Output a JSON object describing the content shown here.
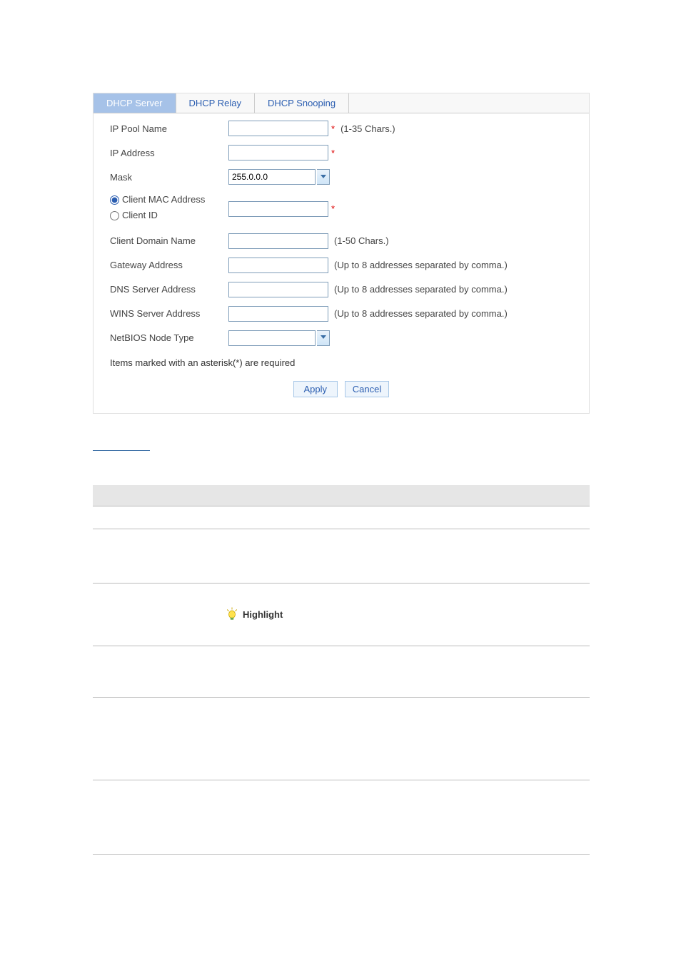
{
  "tabs": {
    "server": "DHCP Server",
    "relay": "DHCP Relay",
    "snooping": "DHCP Snooping"
  },
  "form": {
    "ip_pool_name": {
      "label": "IP Pool Name",
      "value": "",
      "hint": "(1-35 Chars.)",
      "req": "*"
    },
    "ip_address": {
      "label": "IP Address",
      "value": "",
      "req": "*"
    },
    "mask": {
      "label": "Mask",
      "value": "255.0.0.0"
    },
    "client_mac_label": "Client MAC Address",
    "client_id_label": "Client ID",
    "client_bind_value": "",
    "client_bind_req": "*",
    "client_domain": {
      "label": "Client Domain Name",
      "value": "",
      "hint": "(1-50 Chars.)"
    },
    "gateway": {
      "label": "Gateway Address",
      "value": "",
      "hint": "(Up to 8 addresses separated by comma.)"
    },
    "dns": {
      "label": "DNS Server Address",
      "value": "",
      "hint": "(Up to 8 addresses separated by comma.)"
    },
    "wins": {
      "label": "WINS Server Address",
      "value": "",
      "hint": "(Up to 8 addresses separated by comma.)"
    },
    "netbios": {
      "label": "NetBIOS Node Type",
      "value": ""
    },
    "required_note": "Items marked with an asterisk(*) are required",
    "apply": "Apply",
    "cancel": "Cancel"
  },
  "highlight_label": "Highlight"
}
